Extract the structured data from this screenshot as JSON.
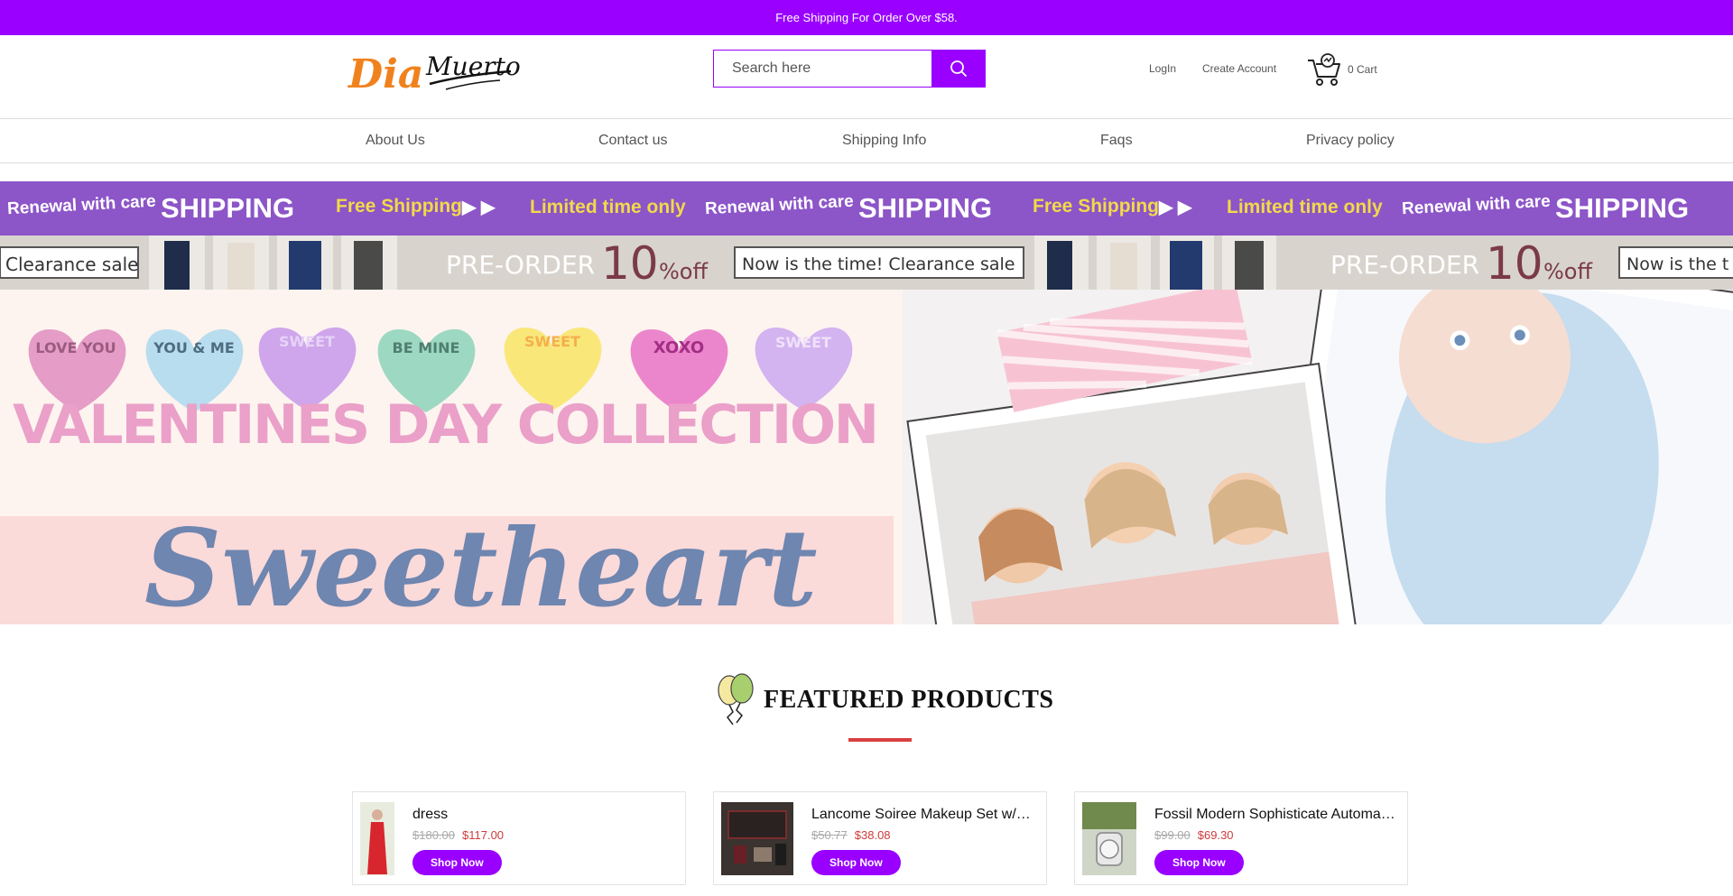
{
  "topbar": {
    "text": "Free Shipping For Order Over $58."
  },
  "header": {
    "logo": {
      "word1": "Dia",
      "word2": "Muertos"
    },
    "search": {
      "placeholder": "Search here"
    },
    "login": "LogIn",
    "create_account": "Create Account",
    "cart": "0 Cart"
  },
  "nav": [
    "About Us",
    "Contact us",
    "Shipping Info",
    "Faqs",
    "Privacy policy"
  ],
  "promo_band": {
    "items": [
      "Renewal with care",
      "SHIPPING",
      "Free Shipping",
      "Limited time only"
    ],
    "preorder": "PRE-ORDER",
    "discount_num": "10",
    "discount_unit": "%off",
    "clearance": "Now is the time! Clearance sale",
    "clearance_short": "Clearance sale",
    "clearance_cut": "Now is the t"
  },
  "hero": {
    "hearts": [
      "LOVE YOU",
      "YOU & ME",
      "SWEET",
      "BE MINE",
      "SWEET",
      "XOXO",
      "SWEET"
    ],
    "headline": "VALENTINES DAY COLLECTION",
    "script": "Sweetheart"
  },
  "featured": {
    "title": "FEATURED PRODUCTS"
  },
  "products": [
    {
      "name": "dress",
      "old_price": "$180.00",
      "price": "$117.00",
      "cta": "Shop Now"
    },
    {
      "name": "Lancome Soiree Makeup Set w/…",
      "old_price": "$50.77",
      "price": "$38.08",
      "cta": "Shop Now"
    },
    {
      "name": "Fossil Modern Sophisticate Automa…",
      "old_price": "$99.00",
      "price": "$69.30",
      "cta": "Shop Now"
    }
  ],
  "colors": {
    "brand": "#9900ff",
    "sale": "#d03a3a",
    "rule": "#d94040"
  }
}
